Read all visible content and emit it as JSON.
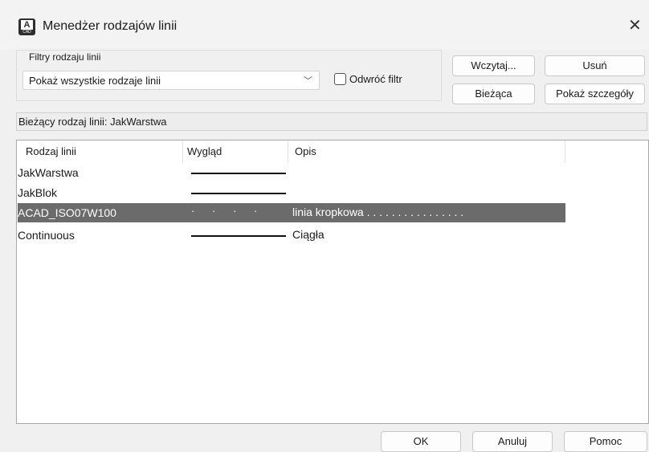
{
  "window": {
    "title": "Menedżer rodzajów linii",
    "close_glyph": "✕",
    "icon_letter": "A",
    "icon_caption": "CAD"
  },
  "filters": {
    "legend": "Filtry rodzaju linii",
    "selected": "Pokaż wszystkie rodzaje linii",
    "arrow": "﹀",
    "invert_label": "Odwróć filtr",
    "invert_checked": false
  },
  "buttons": {
    "load": "Wczytaj...",
    "delete": "Usuń",
    "current": "Bieżąca",
    "details": "Pokaż szczegóły",
    "ok": "OK",
    "cancel": "Anuluj",
    "help": "Pomoc"
  },
  "current": {
    "label": "Bieżący rodzaj linii:  JakWarstwa"
  },
  "table": {
    "columns": [
      "Rodzaj linii",
      "Wygląd",
      "Opis"
    ],
    "rows": [
      {
        "name": "JakWarstwa",
        "appearance": "solid",
        "description": ""
      },
      {
        "name": "JakBlok",
        "appearance": "solid",
        "description": ""
      },
      {
        "name": "ACAD_ISO07W100",
        "appearance": "dotted",
        "description": "linia kropkowa . . . . . . . . . . . . . . . ."
      },
      {
        "name": "Continuous",
        "appearance": "solid",
        "description": "Ciągła"
      }
    ],
    "selected_row": 2
  },
  "dots_sample": "·      ·      ·      ·"
}
